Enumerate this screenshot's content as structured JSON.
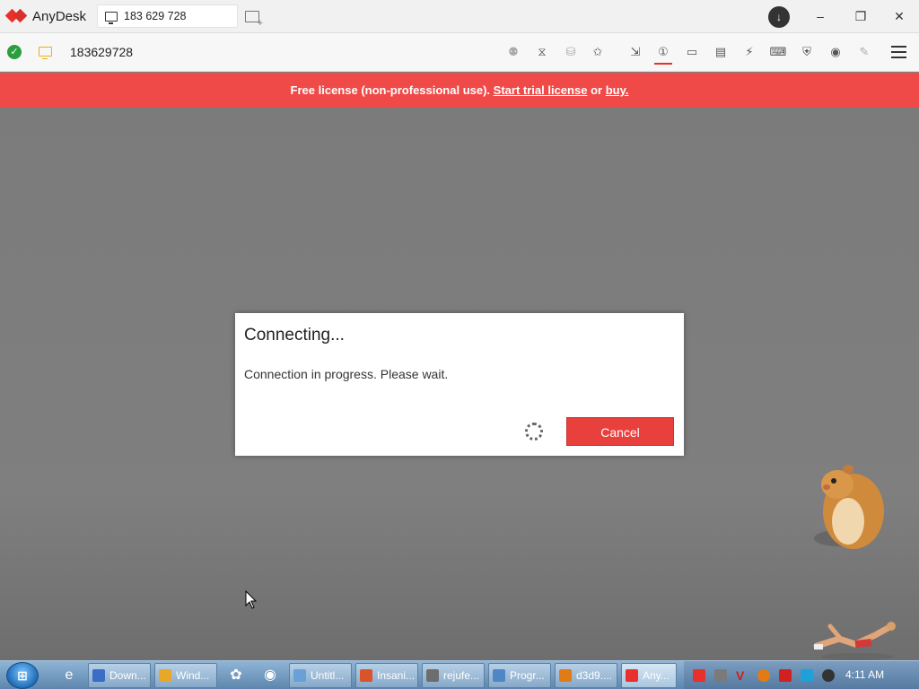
{
  "app": {
    "name": "AnyDesk",
    "tab_label": "183 629 728"
  },
  "address_bar": {
    "address": "183629728"
  },
  "banner": {
    "prefix": "Free license (non-professional use). ",
    "trial_link": "Start trial license",
    "or_text": " or ",
    "buy_link": "buy."
  },
  "dialog": {
    "title": "Connecting...",
    "message": "Connection in progress. Please wait.",
    "cancel_label": "Cancel"
  },
  "taskbar": {
    "items": [
      {
        "label": "Down...",
        "color": "#3b6cc7"
      },
      {
        "label": "Wind...",
        "color": "#e7a72a"
      },
      {
        "label": "Untitl...",
        "color": "#6aa0d8"
      },
      {
        "label": "Insani...",
        "color": "#d9532b"
      },
      {
        "label": "rejufe...",
        "color": "#6d6d6d"
      },
      {
        "label": "Progr...",
        "color": "#4f86c6"
      },
      {
        "label": "d3d9....",
        "color": "#e07b16"
      },
      {
        "label": "Any...",
        "color": "#e8302c"
      }
    ],
    "clock": "4:11 AM"
  },
  "colors": {
    "accent": "#e8302c",
    "banner": "#f04a48",
    "ok": "#2b9e3e"
  }
}
